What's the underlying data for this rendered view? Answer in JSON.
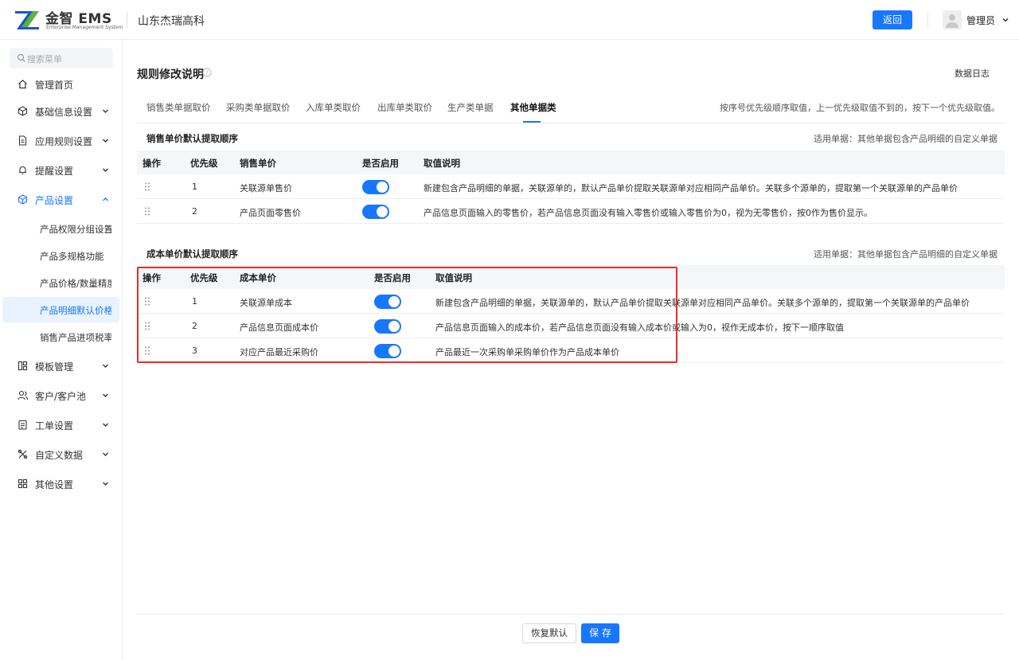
{
  "header": {
    "logo_text": "金智 EMS",
    "logo_subtitle": "Enterprise Management System",
    "company": "山东杰瑞高科",
    "back_label": "返回",
    "user_name": "管理员"
  },
  "sidebar": {
    "search_placeholder": "搜索菜单",
    "items": [
      {
        "label": "管理首页",
        "icon": "home-icon"
      },
      {
        "label": "基础信息设置",
        "icon": "cube-icon"
      },
      {
        "label": "应用规则设置",
        "icon": "document-icon"
      },
      {
        "label": "提醒设置",
        "icon": "bell-icon"
      },
      {
        "label": "产品设置",
        "icon": "cube-icon"
      },
      {
        "label": "模板管理",
        "icon": "template-icon"
      },
      {
        "label": "客户/客户池",
        "icon": "users-icon"
      },
      {
        "label": "工单设置",
        "icon": "clipboard-icon"
      },
      {
        "label": "自定义数据",
        "icon": "tools-icon"
      },
      {
        "label": "其他设置",
        "icon": "grid-icon"
      }
    ],
    "product_sub_items": [
      "产品权限分组设置",
      "产品多规格功能",
      "产品价格/数量精度",
      "产品明细默认价格",
      "销售产品进项税率"
    ],
    "active_item": "产品设置",
    "active_sub_item": "产品明细默认价格"
  },
  "page": {
    "title": "规则修改说明",
    "log_link": "数据日志",
    "tabs": [
      "销售类单据取价",
      "采购类单据取价",
      "入库单类取价",
      "出库单类取价",
      "生产类单据",
      "其他单据类"
    ],
    "active_tab": "其他单据类",
    "tab_tip": "按序号优先级顺序取值，上一优先级取值不到的，按下一个优先级取值。"
  },
  "sales_section": {
    "title": "销售单价默认提取顺序",
    "tip": "适用单据：其他单据包含产品明细的自定义单据",
    "headers": [
      "操作",
      "优先级",
      "销售单价",
      "是否启用",
      "取值说明"
    ],
    "rows": [
      {
        "priority": "1",
        "name": "关联源单售价",
        "enabled": true,
        "desc": "新建包含产品明细的单据，关联源单的，默认产品单价提取关联源单对应相同产品单价。关联多个源单的，提取第一个关联源单的产品单价"
      },
      {
        "priority": "2",
        "name": "产品页面零售价",
        "enabled": true,
        "desc": "产品信息页面输入的零售价，若产品信息页面没有输入零售价或输入零售价为0，视为无零售价，按0作为售价显示。"
      }
    ]
  },
  "cost_section": {
    "title": "成本单价默认提取顺序",
    "tip": "适用单据：其他单据包含产品明细的自定义单据",
    "headers": [
      "操作",
      "优先级",
      "成本单价",
      "是否启用",
      "取值说明"
    ],
    "rows": [
      {
        "priority": "1",
        "name": "关联源单成本",
        "enabled": true,
        "desc": "新建包含产品明细的单据，关联源单的，默认产品单价提取关联源单对应相同产品单价。关联多个源单的，提取第一个关联源单的产品单价"
      },
      {
        "priority": "2",
        "name": "产品信息页面成本价",
        "enabled": true,
        "desc": "产品信息页面输入的成本价，若产品信息页面没有输入成本价或输入为0，视作无成本价，按下一顺序取值"
      },
      {
        "priority": "3",
        "name": "对应产品最近采购价",
        "enabled": true,
        "desc": "产品最近一次采购单采购单价作为产品成本单价"
      }
    ]
  },
  "footer": {
    "reset_label": "恢复默认",
    "save_label": "保 存"
  },
  "colors": {
    "primary": "#1677ff",
    "highlight_border": "#ee2a2a"
  }
}
